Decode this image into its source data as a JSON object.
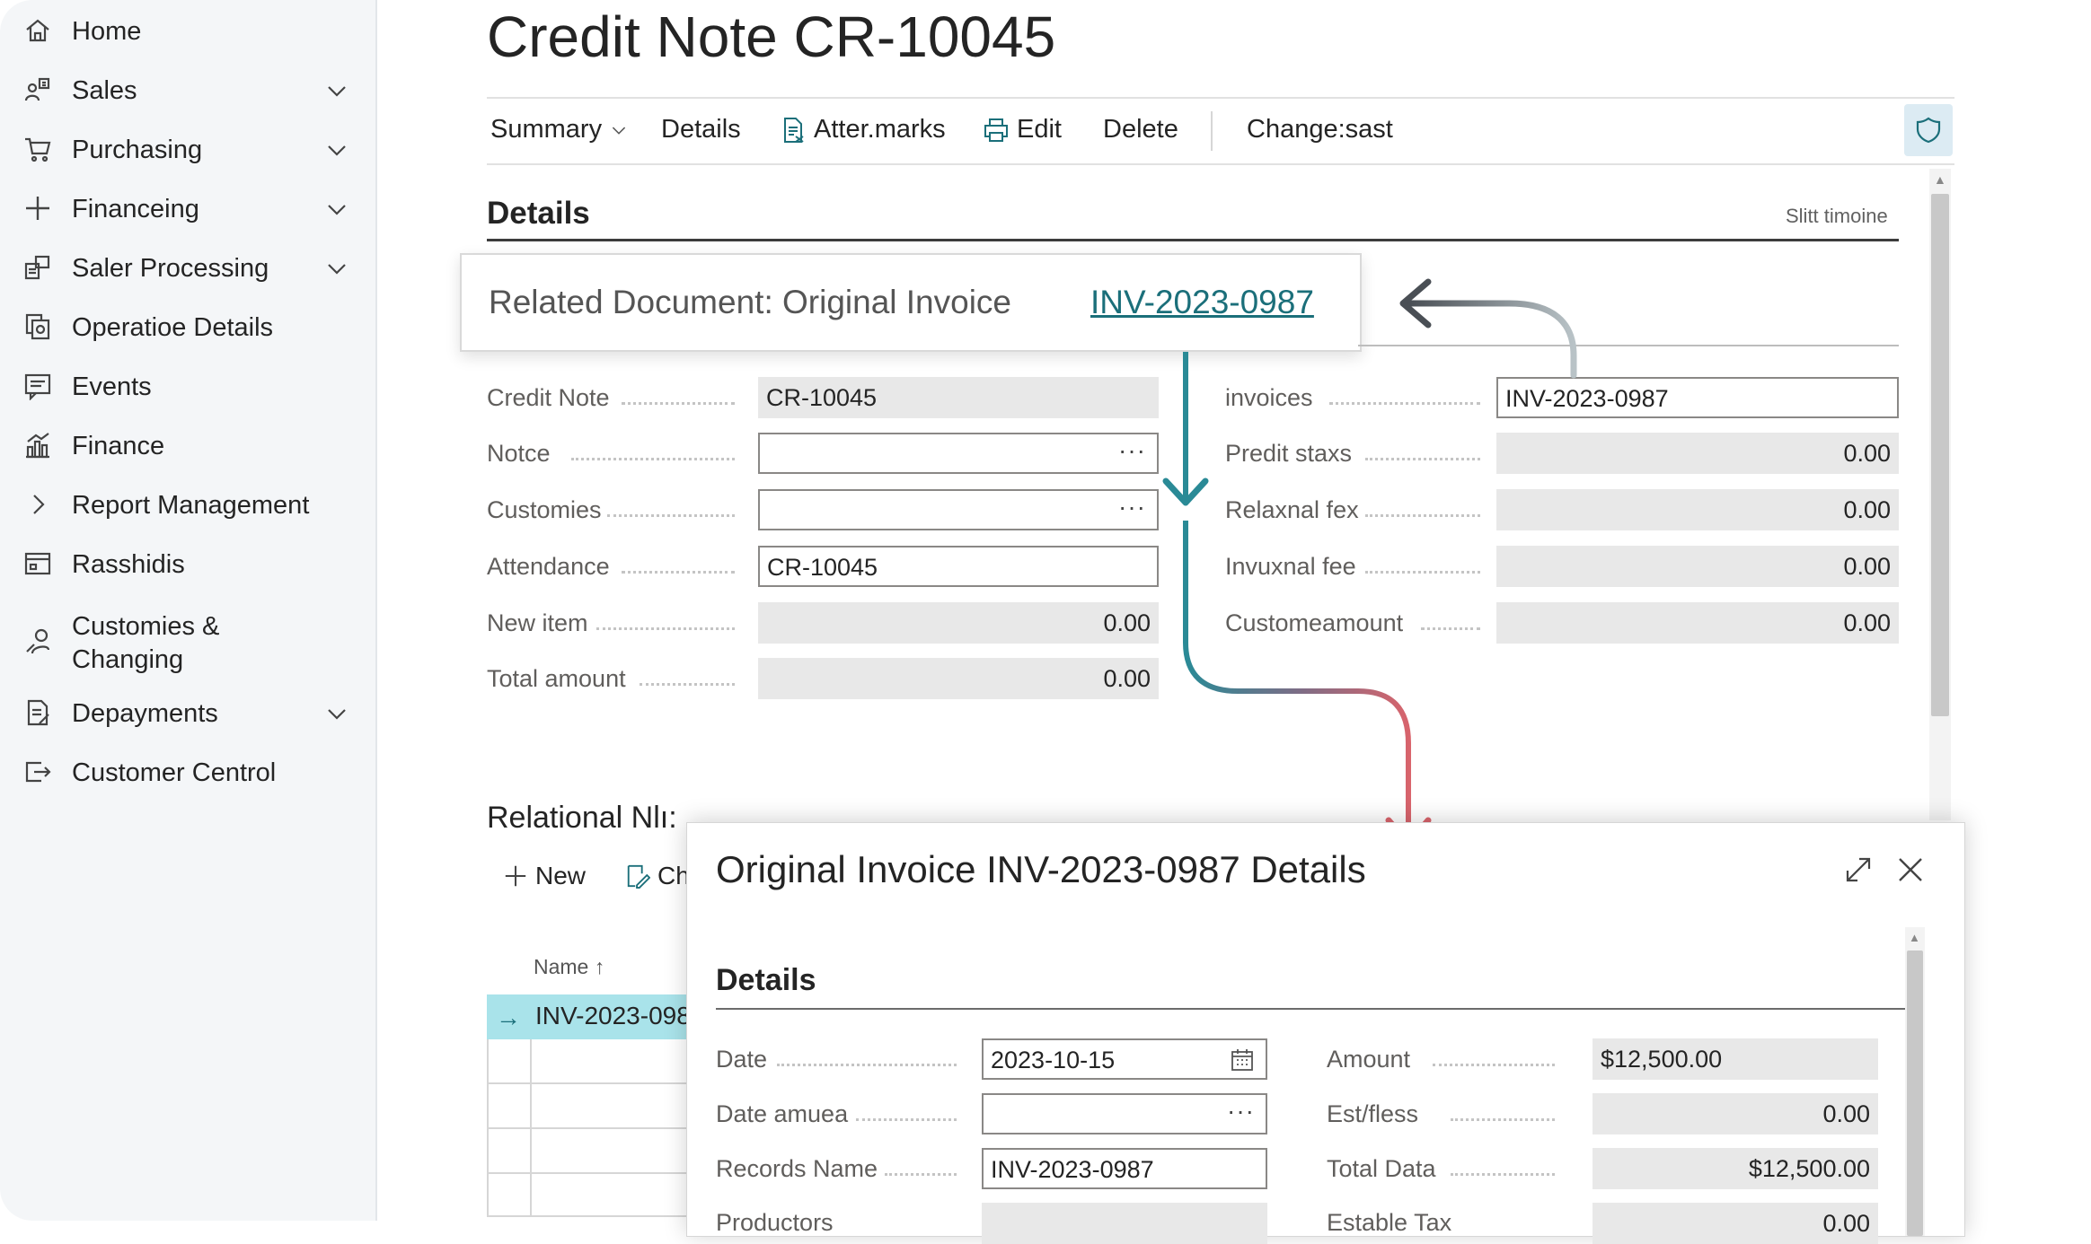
{
  "sidebar": {
    "items": [
      {
        "label": "Home",
        "icon": "home-icon",
        "expandable": false
      },
      {
        "label": "Sales",
        "icon": "sales-icon",
        "expandable": true
      },
      {
        "label": "Purchasing",
        "icon": "cart-icon",
        "expandable": true
      },
      {
        "label": "Financeing",
        "icon": "plus-icon",
        "expandable": true
      },
      {
        "label": "Saler Processing",
        "icon": "processing-icon",
        "expandable": true
      },
      {
        "label": "Operatioe Details",
        "icon": "documents-icon",
        "expandable": false
      },
      {
        "label": "Events",
        "icon": "events-icon",
        "expandable": false
      },
      {
        "label": "Finance",
        "icon": "chart-icon",
        "expandable": false
      },
      {
        "label": "Report Management",
        "icon": "chevron-right-icon",
        "expandable": false
      },
      {
        "label": "Rasshidis",
        "icon": "card-icon",
        "expandable": false
      },
      {
        "label": "Customies & Changing",
        "icon": "people-icon",
        "expandable": false
      },
      {
        "label": "Depayments",
        "icon": "payments-icon",
        "expandable": true
      },
      {
        "label": "Customer Centrol",
        "icon": "exit-icon",
        "expandable": false
      }
    ]
  },
  "page": {
    "title": "Credit Note CR-10045"
  },
  "actions": {
    "summary": "Summary",
    "details": "Details",
    "attachments": "Atter.marks",
    "edit": "Edit",
    "delete": "Delete",
    "change": "Change:sast"
  },
  "details_section": {
    "title": "Details",
    "side_link": "Slitt timoine"
  },
  "related": {
    "label": "Related Document: Original Invoice",
    "link": "INV-2023-0987"
  },
  "left_fields": [
    {
      "label": "Credit Note",
      "value": "CR-10045",
      "kind": "ro"
    },
    {
      "label": "Notce",
      "value": "",
      "kind": "lookup"
    },
    {
      "label": "Customies",
      "value": "",
      "kind": "lookup"
    },
    {
      "label": "Attendance",
      "value": "CR-10045",
      "kind": "ed"
    },
    {
      "label": "New item",
      "value": "0.00",
      "kind": "num"
    },
    {
      "label": "Total amount",
      "value": "0.00",
      "kind": "num"
    }
  ],
  "right_fields": [
    {
      "label": "invoices",
      "value": "INV-2023-0987",
      "kind": "ed"
    },
    {
      "label": "Predit staxs",
      "value": "0.00",
      "kind": "num"
    },
    {
      "label": "Relaxnal fex",
      "value": "0.00",
      "kind": "num"
    },
    {
      "label": "Invuxnal fee",
      "value": "0.00",
      "kind": "num"
    },
    {
      "label": "Customeamount",
      "value": "0.00",
      "kind": "num"
    }
  ],
  "relational": {
    "title": "Relational Nlı:",
    "new_label": "New",
    "change_label": "Ch",
    "column": "Name ↑",
    "row": "INV-2023-098"
  },
  "dialog": {
    "title": "Original Invoice INV-2023-0987 Details",
    "section": "Details",
    "left_fields": [
      {
        "label": "Date",
        "value": "2023-10-15",
        "kind": "date"
      },
      {
        "label": "Date amuea",
        "value": "",
        "kind": "lookup"
      },
      {
        "label": "Records Name",
        "value": "INV-2023-0987",
        "kind": "ed"
      },
      {
        "label": "Productors",
        "value": "",
        "kind": "ro"
      }
    ],
    "right_fields": [
      {
        "label": "Amount",
        "value": "$12,500.00",
        "kind": "ro"
      },
      {
        "label": "Est/fless",
        "value": "0.00",
        "kind": "num"
      },
      {
        "label": "Total Data",
        "value": "$12,500.00",
        "kind": "num"
      },
      {
        "label": "Estable Tax",
        "value": "0.00",
        "kind": "num"
      }
    ]
  },
  "colors": {
    "accent": "#1b6f7a",
    "teal_arrow": "#2a8a96",
    "red_arrow": "#d9646c",
    "selection": "#a9e3ea"
  }
}
